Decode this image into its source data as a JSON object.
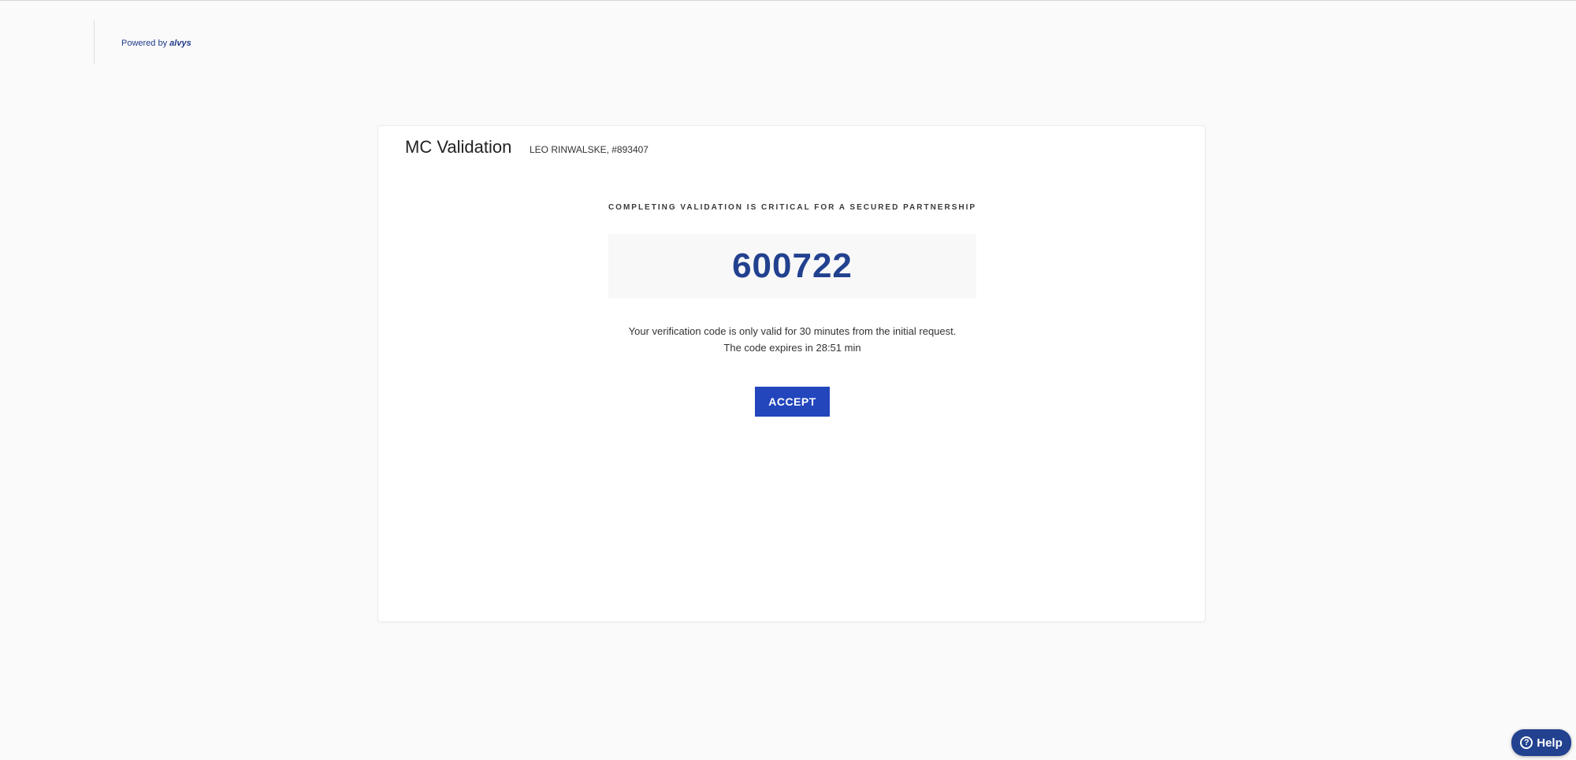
{
  "branding": {
    "powered_by": "Powered by",
    "brand_name": "alvys"
  },
  "card": {
    "title": "MC Validation",
    "subtitle": "LEO RINWALSKE, #893407",
    "critical_note": "COMPLETING VALIDATION IS CRITICAL FOR A SECURED PARTNERSHIP",
    "verification_code": "600722",
    "validity_line1": "Your verification code is only valid for 30 minutes from the initial request.",
    "validity_line2": "The code expires in 28:51 min",
    "accept_label": "ACCEPT"
  },
  "help": {
    "icon": "question-circle-icon",
    "icon_glyph": "?",
    "label": "Help"
  },
  "colors": {
    "brand_blue": "#22418f",
    "button_blue": "#2346bd",
    "page_background": "#fafafa"
  }
}
